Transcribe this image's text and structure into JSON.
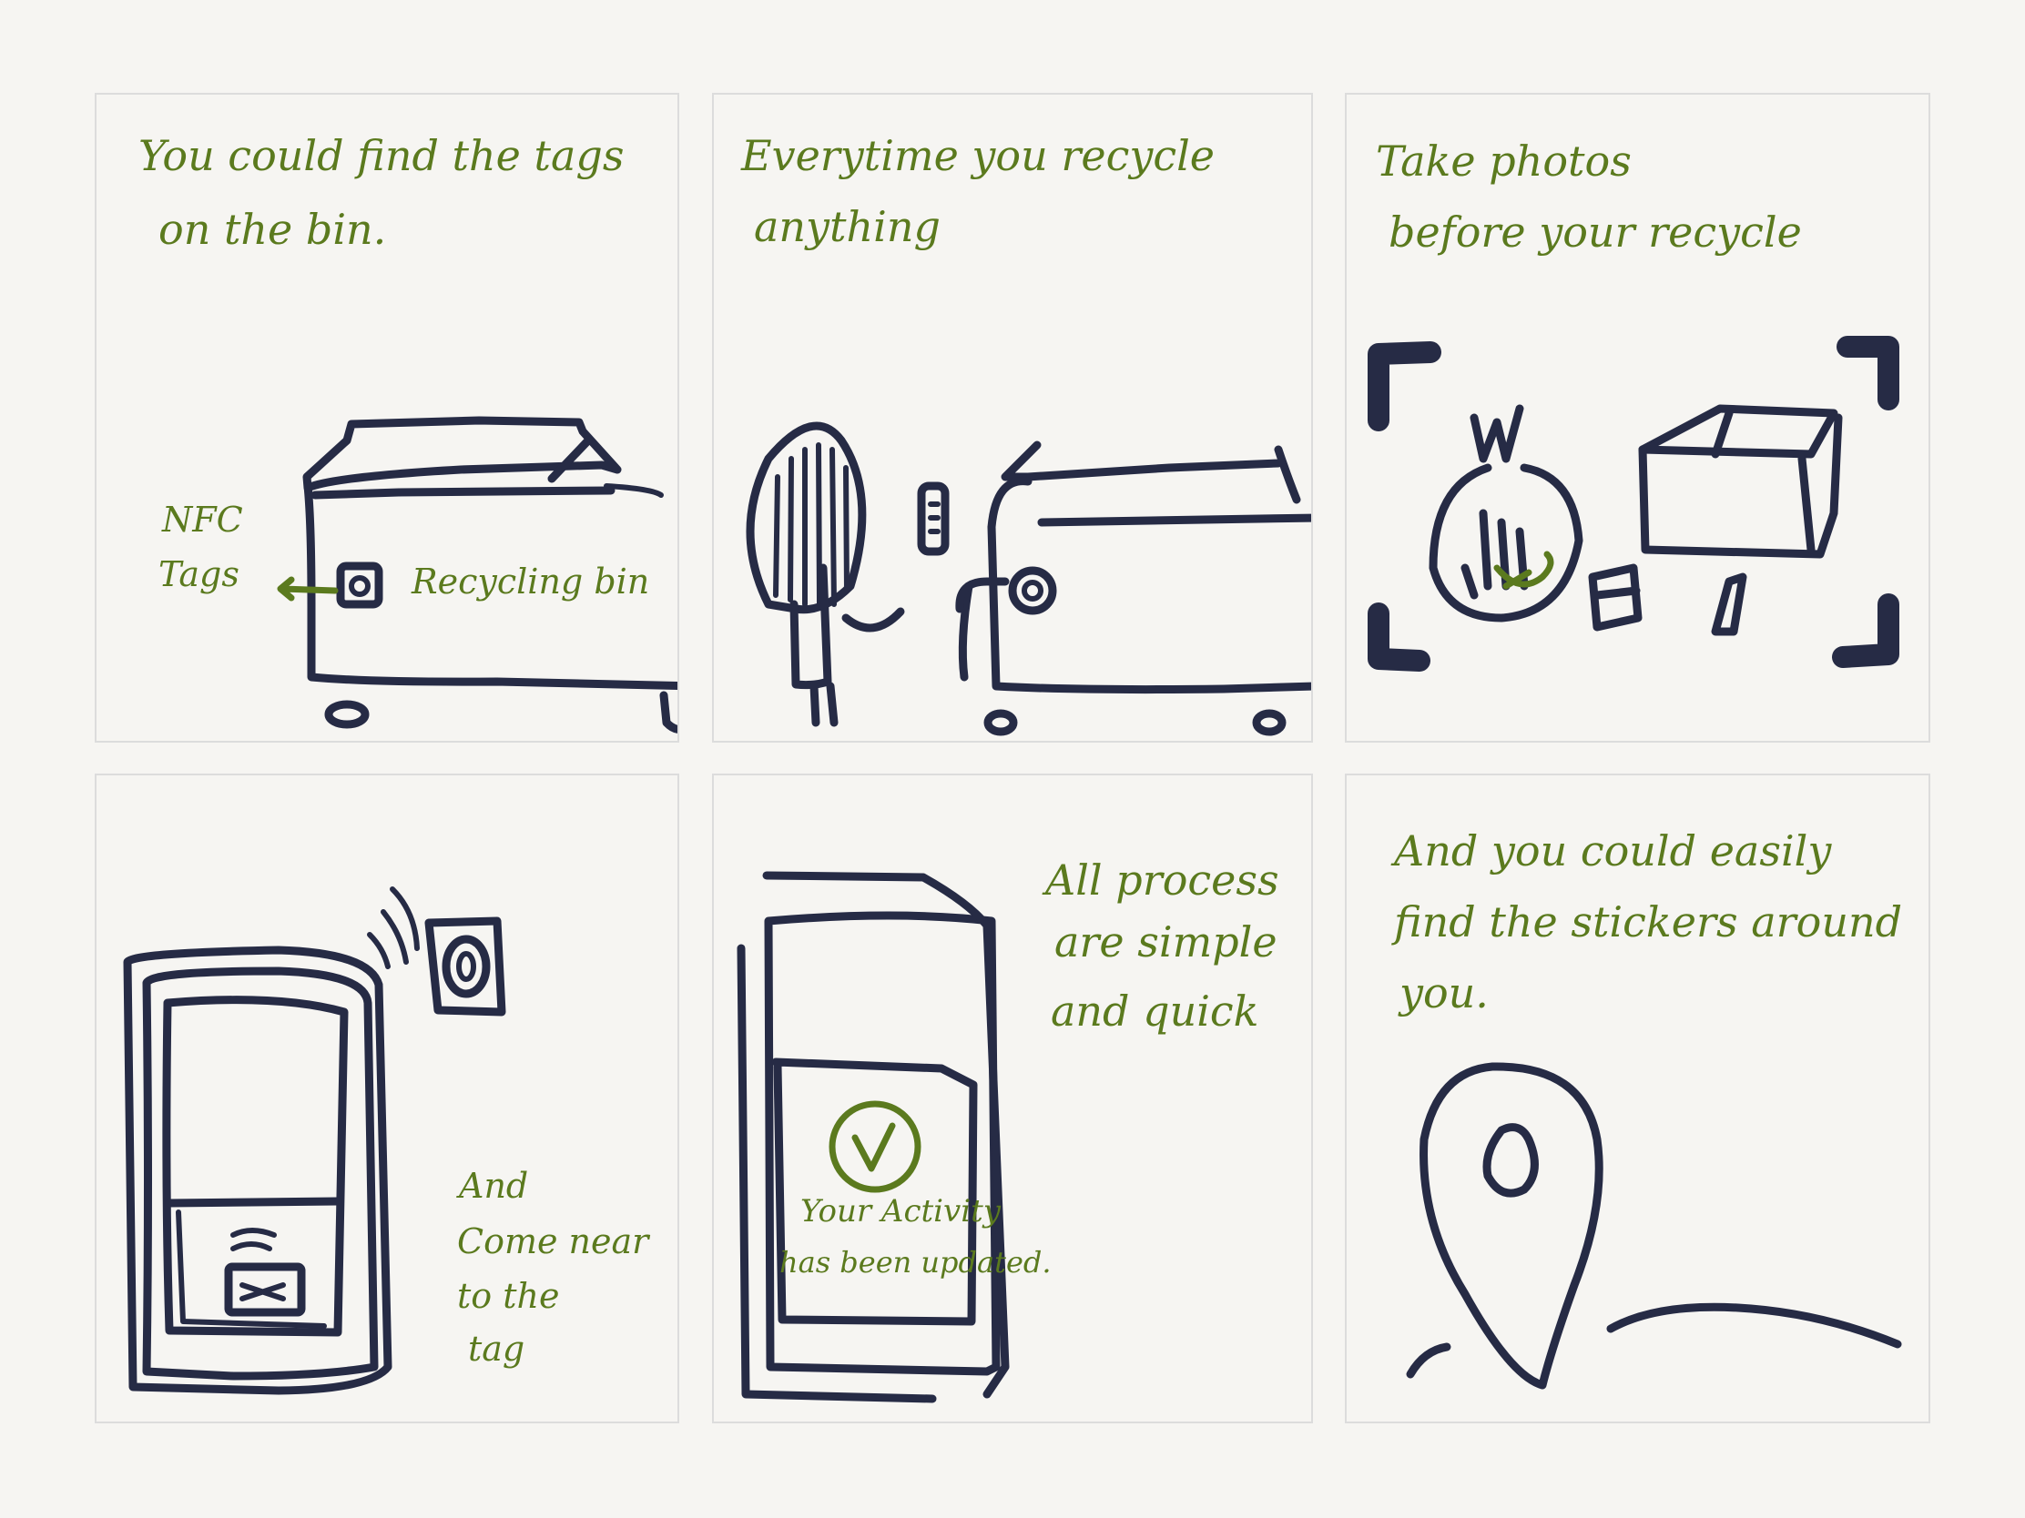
{
  "panels": [
    {
      "id": "p1",
      "lines": [
        "You could find the tags",
        "on the bin."
      ],
      "labels": {
        "nfc_line1": "NFC",
        "nfc_line2": "Tags",
        "bin": "Recycling bin"
      }
    },
    {
      "id": "p2",
      "lines": [
        "Everytime you recycle",
        "anything"
      ]
    },
    {
      "id": "p3",
      "lines": [
        "Take photos",
        "before your recycle"
      ]
    },
    {
      "id": "p4",
      "lines": [
        "And",
        "Come near",
        "to the",
        "tag"
      ]
    },
    {
      "id": "p5",
      "lines": [
        "All process",
        "are simple",
        "and quick"
      ],
      "screen": {
        "line1": "Your Activity",
        "line2": "has been updated."
      }
    },
    {
      "id": "p6",
      "lines": [
        "And you could easily",
        "find the stickers around",
        "you."
      ]
    }
  ],
  "colors": {
    "ink": "#262b45",
    "handwriting": "#5b7a1e",
    "background": "#f6f5f2",
    "panel_border": "#dcdcdc"
  },
  "icons": [
    "nfc-tag-icon",
    "check-circle-icon",
    "map-pin-icon",
    "camera-frame-icon"
  ]
}
